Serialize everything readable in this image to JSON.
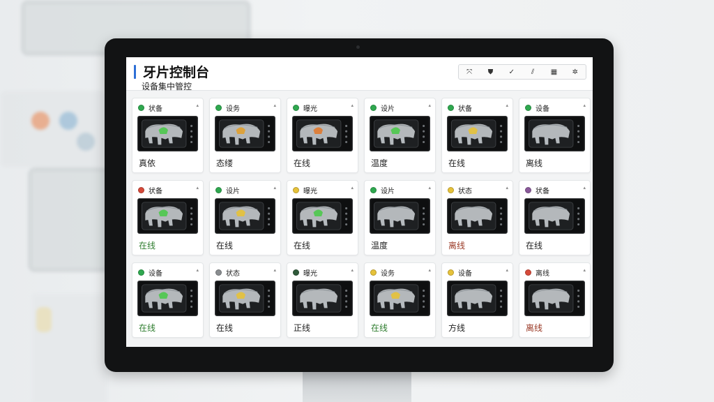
{
  "app": {
    "title": "牙片控制台",
    "subtitle": "设备集中管控"
  },
  "toolbar": [
    {
      "icon": "expand-icon",
      "glyph": "⤧"
    },
    {
      "icon": "tooth-icon",
      "glyph": "⛊"
    },
    {
      "icon": "check-icon",
      "glyph": "✓"
    },
    {
      "icon": "filter-icon",
      "glyph": "⫽"
    },
    {
      "icon": "grid-icon",
      "glyph": "▦"
    },
    {
      "icon": "settings-icon",
      "glyph": "✲"
    }
  ],
  "devices": [
    {
      "name": "状备",
      "dot": "#2fa84f",
      "status": "真依",
      "status_type": "normal",
      "accent": "#4cc94c"
    },
    {
      "name": "设务",
      "dot": "#2fa84f",
      "status": "态缕",
      "status_type": "normal",
      "accent": "#e0a030"
    },
    {
      "name": "曝光",
      "dot": "#2fa84f",
      "status": "在线",
      "status_type": "normal",
      "accent": "#e07a30"
    },
    {
      "name": "设片",
      "dot": "#2fa84f",
      "status": "温度",
      "status_type": "normal",
      "accent": "#4cc94c"
    },
    {
      "name": "状备",
      "dot": "#2fa84f",
      "status": "在线",
      "status_type": "normal",
      "accent": "#e6c23a"
    },
    {
      "name": "设备",
      "dot": "#2fa84f",
      "status": "离线",
      "status_type": "normal",
      "accent": ""
    },
    {
      "name": "状备",
      "dot": "#d64a3a",
      "status": "在线",
      "status_type": "online",
      "accent": "#4cc94c"
    },
    {
      "name": "设片",
      "dot": "#2fa84f",
      "status": "在线",
      "status_type": "normal",
      "accent": "#e6c23a"
    },
    {
      "name": "曝光",
      "dot": "#e6c23a",
      "status": "在线",
      "status_type": "normal",
      "accent": "#4cc94c"
    },
    {
      "name": "设片",
      "dot": "#2fa84f",
      "status": "温度",
      "status_type": "normal",
      "accent": ""
    },
    {
      "name": "状态",
      "dot": "#e6c23a",
      "status": "离线",
      "status_type": "offline",
      "accent": ""
    },
    {
      "name": "状备",
      "dot": "#8a5a9a",
      "status": "在线",
      "status_type": "normal",
      "accent": ""
    },
    {
      "name": "设备",
      "dot": "#2fa84f",
      "status": "在线",
      "status_type": "online",
      "accent": "#4cc94c"
    },
    {
      "name": "状态",
      "dot": "#8a8d90",
      "status": "在线",
      "status_type": "normal",
      "accent": "#e6c23a"
    },
    {
      "name": "曝光",
      "dot": "#2f5a3a",
      "status": "正线",
      "status_type": "normal",
      "accent": ""
    },
    {
      "name": "设务",
      "dot": "#e6c23a",
      "status": "在线",
      "status_type": "online",
      "accent": "#e6c23a"
    },
    {
      "name": "设备",
      "dot": "#e6c23a",
      "status": "方线",
      "status_type": "normal",
      "accent": ""
    },
    {
      "name": "离线",
      "dot": "#d64a3a",
      "status": "离线",
      "status_type": "offline",
      "accent": ""
    }
  ]
}
